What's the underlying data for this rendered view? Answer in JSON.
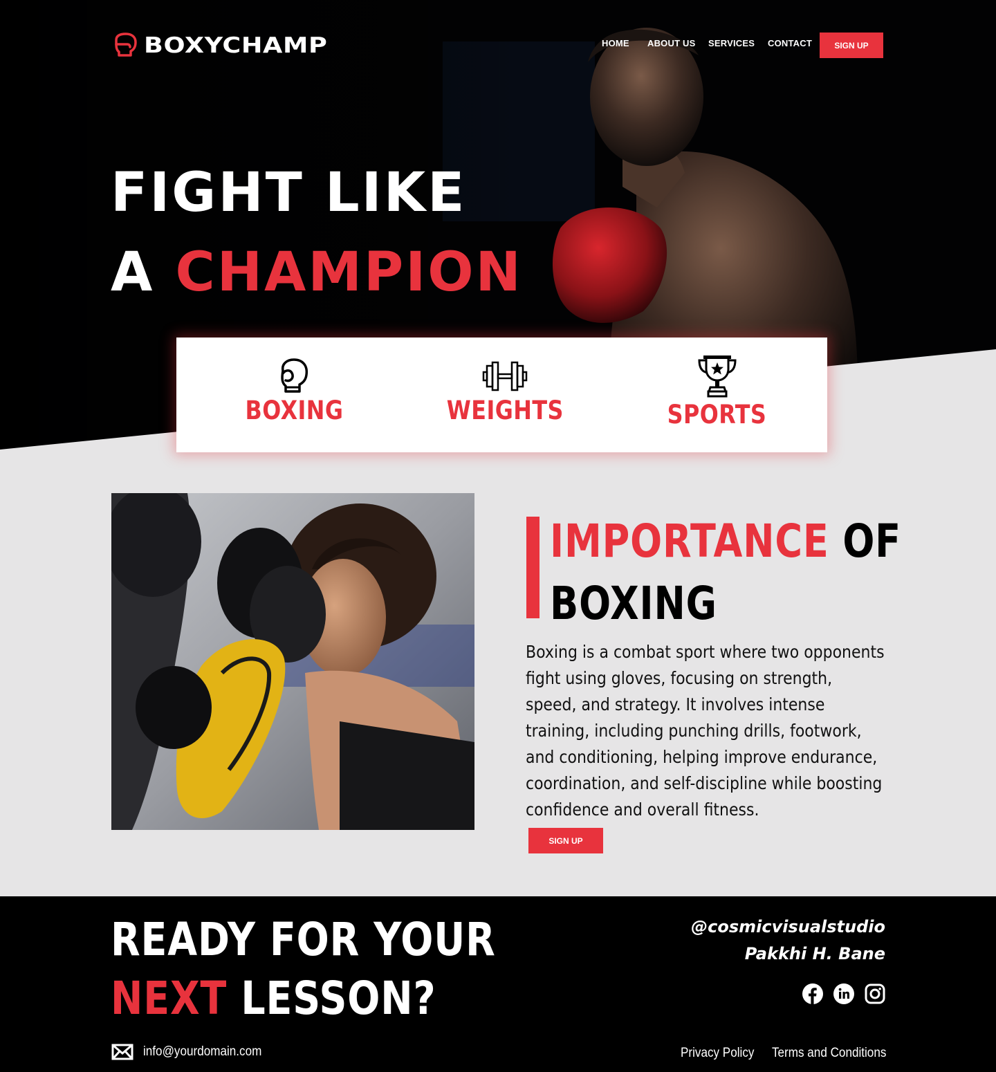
{
  "brand": {
    "name": "BOXYCHAMP",
    "accent": "#e8333d",
    "logo_icon": "boxing-glove-icon"
  },
  "nav": {
    "items": [
      "HOME",
      "ABOUT US",
      "SERVICES",
      "CONTACT"
    ],
    "signup_label": "SIGN UP"
  },
  "hero": {
    "line1": "FIGHT LIKE",
    "line2_prefix": "A ",
    "line2_highlight": "CHAMPION"
  },
  "features": [
    {
      "label": "BOXING",
      "icon": "boxing-glove-icon"
    },
    {
      "label": "WEIGHTS",
      "icon": "dumbbell-icon"
    },
    {
      "label": "SPORTS",
      "icon": "trophy-icon"
    }
  ],
  "about": {
    "heading_highlight": "IMPORTANCE",
    "heading_rest1": " OF",
    "heading_rest2": "BOXING",
    "body": "Boxing is a combat sport where two opponents fight using gloves, focusing on strength, speed, and strategy. It involves intense training, including punching drills, footwork, and conditioning, helping improve endurance, coordination, and self-discipline while boosting confidence and overall fitness.",
    "signup_label": "SIGN UP"
  },
  "footer": {
    "cta_line1": "READY FOR YOUR",
    "cta_highlight": "NEXT",
    "cta_rest": " LESSON?",
    "handle": "@cosmicvisualstudio",
    "author": "Pakkhi H. Bane",
    "socials": [
      "facebook-icon",
      "linkedin-icon",
      "instagram-icon"
    ],
    "email": "info@yourdomain.com",
    "links": [
      "Privacy Policy",
      "Terms and Conditions"
    ]
  }
}
